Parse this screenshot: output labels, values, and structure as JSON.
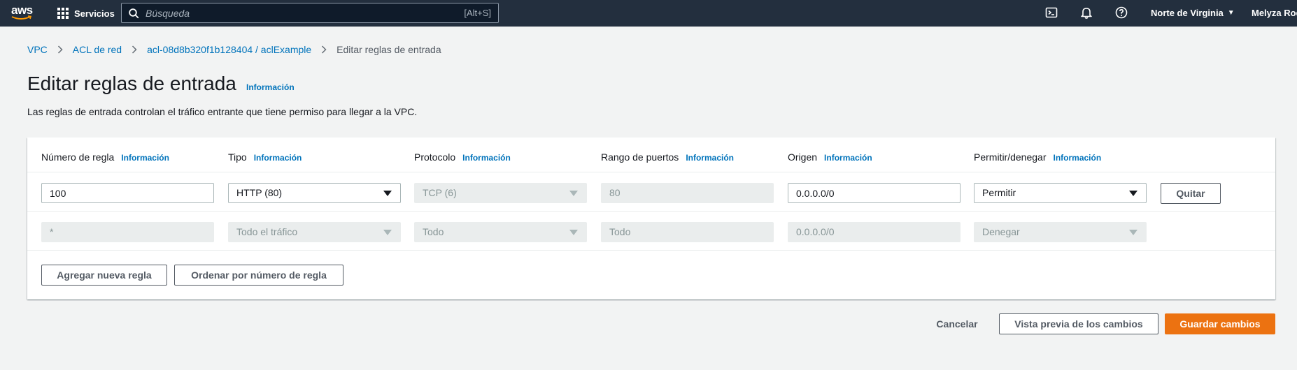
{
  "nav": {
    "logo": "aws",
    "services": "Servicios",
    "search_placeholder": "Búsqueda",
    "search_shortcut": "[Alt+S]",
    "region": "Norte de Virginia",
    "user": "Melyza Rodr"
  },
  "breadcrumb": {
    "items": [
      "VPC",
      "ACL de red",
      "acl-08d8b320f1b128404 / aclExample"
    ],
    "current": "Editar reglas de entrada"
  },
  "page": {
    "title": "Editar reglas de entrada",
    "info": "Información",
    "description": "Las reglas de entrada controlan el tráfico entrante que tiene permiso para llegar a la VPC."
  },
  "table": {
    "info_label": "Información",
    "headers": [
      "Número de regla",
      "Tipo",
      "Protocolo",
      "Rango de puertos",
      "Origen",
      "Permitir/denegar"
    ],
    "rows": [
      {
        "rule": "100",
        "type": "HTTP (80)",
        "protocol": "TCP (6)",
        "ports": "80",
        "source": "0.0.0.0/0",
        "action": "Permitir",
        "remove": "Quitar"
      },
      {
        "rule": "*",
        "type": "Todo el tráfico",
        "protocol": "Todo",
        "ports": "Todo",
        "source": "0.0.0.0/0",
        "action": "Denegar"
      }
    ],
    "add_button": "Agregar nueva regla",
    "sort_button": "Ordenar por número de regla"
  },
  "footer": {
    "cancel": "Cancelar",
    "preview": "Vista previa de los cambios",
    "save": "Guardar cambios"
  },
  "colors": {
    "nav_bg": "#232f3e",
    "link": "#0073bb",
    "primary": "#ec7211",
    "page_bg": "#f2f3f3"
  }
}
